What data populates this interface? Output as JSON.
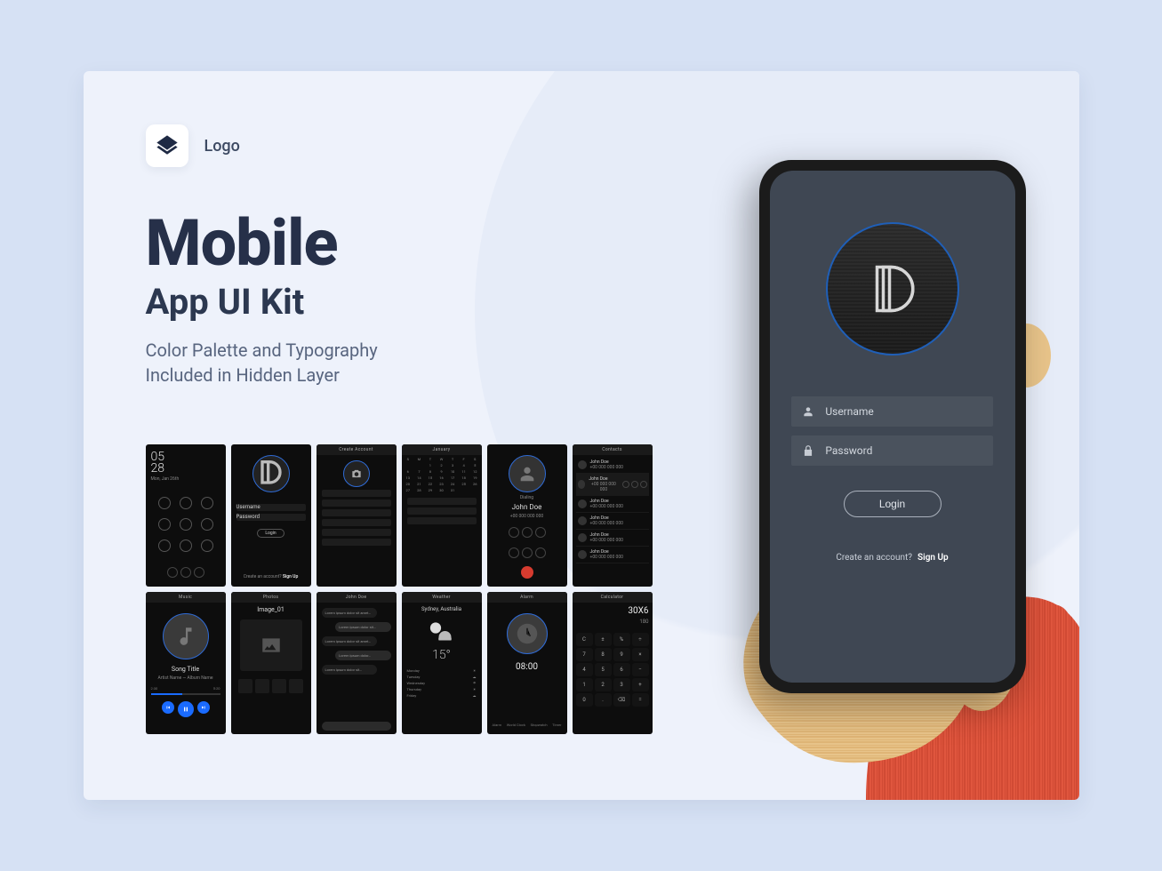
{
  "brand": {
    "label": "Logo"
  },
  "headline": {
    "line1": "Mobile",
    "line2": "App UI Kit"
  },
  "subhead": {
    "line1": "Color Palette and Typography",
    "line2": "Included in Hidden Layer"
  },
  "phone": {
    "username_placeholder": "Username",
    "password_placeholder": "Password",
    "login_label": "Login",
    "signup_prompt": "Create an account?",
    "signup_link": "Sign Up"
  },
  "thumbs": {
    "lock": {
      "time": "05\n28",
      "date": "Mon, Jan 26th"
    },
    "login": {
      "title": "",
      "username": "Username",
      "password": "Password",
      "login": "Login",
      "signup_prompt": "Create an account?",
      "signup_link": "Sign Up"
    },
    "create": {
      "title": "Create Account"
    },
    "calendar": {
      "title": "January"
    },
    "dialing": {
      "label": "Dialing",
      "name": "John Doe",
      "number": "+00 000 000 000"
    },
    "contacts": {
      "title": "Contacts",
      "name": "John Doe",
      "number": "+00 000 000 000"
    },
    "music": {
      "title": "Music",
      "song": "Song Title",
      "artist": "Artist Name — Album Name",
      "elapsed": "2:30",
      "total": "5:20"
    },
    "photos": {
      "title": "Photos",
      "image": "Image_01"
    },
    "chat": {
      "title": "John Doe"
    },
    "weather": {
      "title": "Weather",
      "city": "Sydney, Australia",
      "temp": "15°",
      "days": [
        "Monday",
        "Tuesday",
        "Wednesday",
        "Thursday",
        "Friday"
      ]
    },
    "alarm": {
      "title": "Alarm",
      "time": "08:00",
      "tabs": [
        "Alarm",
        "World Clock",
        "Stopwatch",
        "Timer"
      ]
    },
    "calculator": {
      "title": "Calculator",
      "expr": "30X6",
      "result": "180",
      "keys": [
        "C",
        "±",
        "%",
        "÷",
        "7",
        "8",
        "9",
        "×",
        "4",
        "5",
        "6",
        "−",
        "1",
        "2",
        "3",
        "+",
        "0",
        ".",
        "⌫",
        "="
      ]
    }
  },
  "colors": {
    "bg_outer": "#d6e1f4",
    "bg_canvas": "#eef2fb",
    "dark": "#0d0d0d",
    "phone_screen": "#3f4753",
    "accent_blue": "#1f5fb8"
  }
}
